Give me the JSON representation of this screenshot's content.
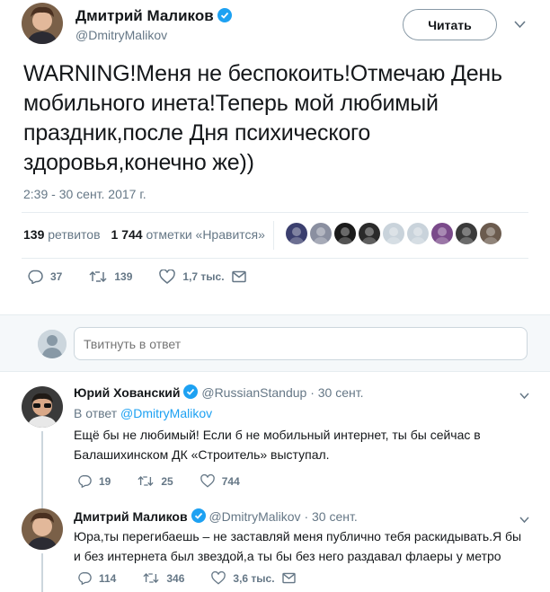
{
  "tweet": {
    "author_name": "Дмитрий Маликов",
    "author_handle": "@DmitryMalikov",
    "follow_label": "Читать",
    "text": "WARNING!Меня не беспокоить!Отмечаю День мобильного инета!Теперь мой любимый праздник,после Дня психического здоровья,конечно же))",
    "date": "2:39 - 30 сент. 2017 г.",
    "retweets_count": "139",
    "retweets_label": "ретвитов",
    "likes_count": "1 744",
    "likes_label": "отметки «Нравится»",
    "replies": "37",
    "retweets": "139",
    "likes": "1,7 тыс.",
    "liker_colors": [
      "#3b3f6e",
      "#8a8fa0",
      "#1a1a1a",
      "#2a2a2a",
      "#c9d3db",
      "#c9d3db",
      "#7a4a8a",
      "#3a3a3a",
      "#6b5b4e"
    ]
  },
  "reply_box": {
    "placeholder": "Твитнуть в ответ"
  },
  "replies": [
    {
      "author_name": "Юрий Хованский",
      "author_handle": "@RussianStandup",
      "time": "· 30 сент.",
      "in_reply_prefix": "В ответ",
      "in_reply_handle": "@DmitryMalikov",
      "text": "Ещё бы не любимый! Если б не мобильный интернет, ты бы сейчас в Балашихинском ДК «Строитель» выступал.",
      "replies": "19",
      "retweets": "25",
      "likes": "744"
    },
    {
      "author_name": "Дмитрий Маликов",
      "author_handle": "@DmitryMalikov",
      "time": "· 30 сент.",
      "text": "Юра,ты перегибаешь – не заставляй меня публично тебя раскидывать.Я бы и без интернета был звездой,а ты бы без него раздавал флаеры у метро",
      "replies": "114",
      "retweets": "346",
      "likes": "3,6 тыс."
    }
  ],
  "colors": {
    "verified": "#1da1f2",
    "muted": "#657786",
    "link": "#1da1f2",
    "divider": "#e6ecf0"
  }
}
